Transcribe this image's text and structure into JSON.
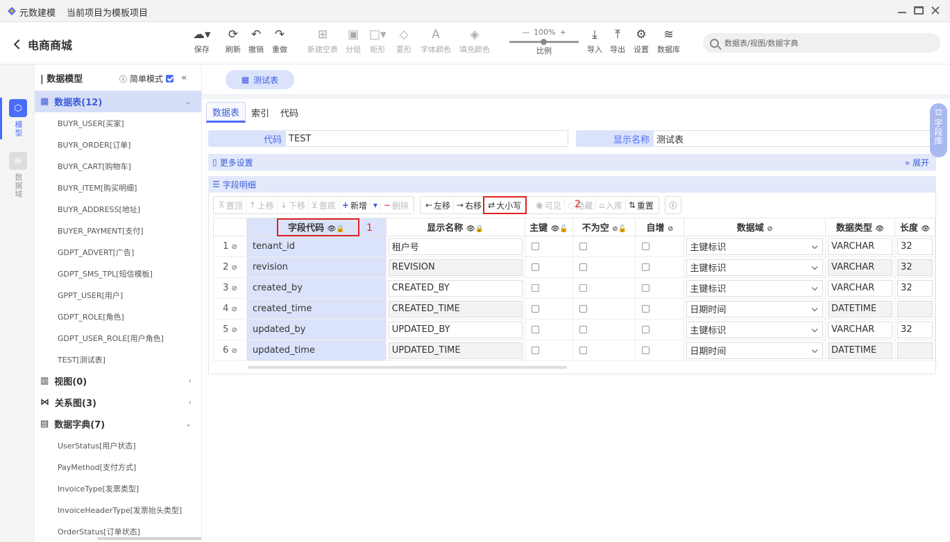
{
  "app": {
    "name": "元数建模",
    "subtitle": "当前项目为模板项目"
  },
  "project": {
    "title": "电商商城"
  },
  "toolbar": {
    "save": "保存",
    "refresh": "刷新",
    "undo": "撤销",
    "redo": "重做",
    "new_table": "新建空表",
    "group": "分组",
    "rect": "矩形",
    "diamond": "菱形",
    "font_color": "字体颜色",
    "fill_color": "填充颜色",
    "zoom_value": "100%",
    "zoom_label": "比例",
    "import": "导入",
    "export": "导出",
    "settings": "设置",
    "database": "数据库"
  },
  "search": {
    "placeholder": "数据表/视图/数据字典"
  },
  "rail": {
    "model": "模型",
    "domain": "数据域"
  },
  "tree": {
    "title": "数据模型",
    "simple_mode": "简单模式",
    "tables_section": "数据表(12)",
    "tables": [
      "BUYR_USER[买家]",
      "BUYR_ORDER[订单]",
      "BUYR_CART[购物车]",
      "BUYR_ITEM[购买明细]",
      "BUYR_ADDRESS[地址]",
      "BUYER_PAYMENT[支付]",
      "GDPT_ADVERT[广告]",
      "GDPT_SMS_TPL[短信模板]",
      "GPPT_USER[用户]",
      "GDPT_ROLE[角色]",
      "GDPT_USER_ROLE[用户角色]",
      "TEST[测试表]"
    ],
    "views_section": "视图(0)",
    "relations_section": "关系图(3)",
    "dict_section": "数据字典(7)",
    "dicts": [
      "UserStatus[用户状态]",
      "PayMethod[支付方式]",
      "InvoiceType[发票类型]",
      "InvoiceHeaderType[发票抬头类型]",
      "OrderStatus[订单状态]"
    ]
  },
  "main_tab": "测试表",
  "subtabs": [
    "数据表",
    "索引",
    "代码"
  ],
  "form": {
    "code_label": "代码",
    "code_value": "TEST",
    "display_label": "显示名称",
    "display_value": "测试表"
  },
  "more_settings": "更多设置",
  "expand": "展开",
  "field_detail": "字段明细",
  "buttons": {
    "top": "置顶",
    "up": "上移",
    "down": "下移",
    "bottom": "置底",
    "add": "新增",
    "delete": "删除",
    "left": "左移",
    "right": "右移",
    "case": "大小写",
    "visible": "可见",
    "hide": "隐藏",
    "store": "入库",
    "reset": "重置"
  },
  "columns": [
    "字段代码",
    "显示名称",
    "主键",
    "不为空",
    "自增",
    "数据域",
    "数据类型",
    "长度"
  ],
  "rows": [
    {
      "n": "1",
      "code": "tenant_id",
      "name": "租户号",
      "domain": "主键标识",
      "type": "VARCHAR",
      "len": "32"
    },
    {
      "n": "2",
      "code": "revision",
      "name": "REVISION",
      "domain": "主键标识",
      "type": "VARCHAR",
      "len": "32"
    },
    {
      "n": "3",
      "code": "created_by",
      "name": "CREATED_BY",
      "domain": "主键标识",
      "type": "VARCHAR",
      "len": "32"
    },
    {
      "n": "4",
      "code": "created_time",
      "name": "CREATED_TIME",
      "domain": "日期时间",
      "type": "DATETIME",
      "len": ""
    },
    {
      "n": "5",
      "code": "updated_by",
      "name": "UPDATED_BY",
      "domain": "主键标识",
      "type": "VARCHAR",
      "len": "32"
    },
    {
      "n": "6",
      "code": "updated_time",
      "name": "UPDATED_TIME",
      "domain": "日期时间",
      "type": "DATETIME",
      "len": ""
    }
  ],
  "annotations": [
    "1",
    "2"
  ],
  "dict_tab": "字段库",
  "colors": {
    "accent": "#4a6cf7",
    "highlight": "#dbe3fa",
    "annotation": "#e02020"
  }
}
